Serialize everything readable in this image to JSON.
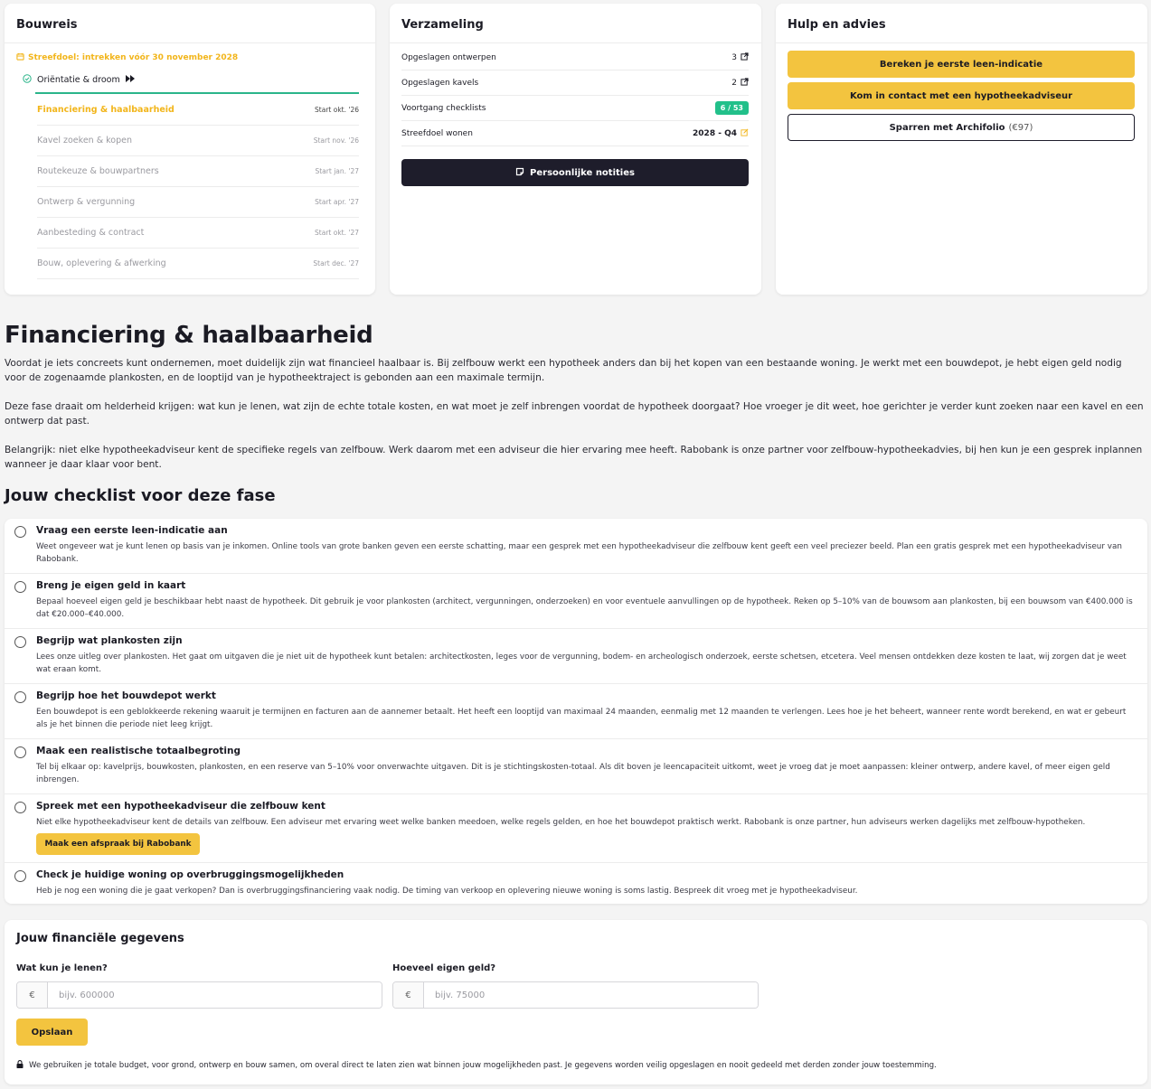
{
  "bouwreis": {
    "title": "Bouwreis",
    "goal": "Streefdoel: intrekken vóór 30 november 2028",
    "done_phase": "Oriëntatie & droom",
    "phases": [
      {
        "label": "Financiering & haalbaarheid",
        "start": "Start okt. '26"
      },
      {
        "label": "Kavel zoeken & kopen",
        "start": "Start nov. '26"
      },
      {
        "label": "Routekeuze & bouwpartners",
        "start": "Start jan. '27"
      },
      {
        "label": "Ontwerp & vergunning",
        "start": "Start apr. '27"
      },
      {
        "label": "Aanbesteding & contract",
        "start": "Start okt. '27"
      },
      {
        "label": "Bouw, oplevering & afwerking",
        "start": "Start dec. '27"
      }
    ]
  },
  "verzameling": {
    "title": "Verzameling",
    "rows": [
      {
        "label": "Opgeslagen ontwerpen",
        "value": "3"
      },
      {
        "label": "Opgeslagen kavels",
        "value": "2"
      },
      {
        "label": "Voortgang checklists",
        "value": "6 / 53"
      },
      {
        "label": "Streefdoel wonen",
        "value": "2028 - Q4"
      }
    ],
    "notes_button": "Persoonlijke notities"
  },
  "hulp": {
    "title": "Hulp en advies",
    "button1": "Bereken je eerste leen-indicatie",
    "button2": "Kom in contact met een hypotheekadviseur",
    "button3": "Sparren met Archifolio",
    "button3_price": "(€97)"
  },
  "phase": {
    "title": "Financiering & haalbaarheid",
    "p1": "Voordat je iets concreets kunt ondernemen, moet duidelijk zijn wat financieel haalbaar is. Bij zelfbouw werkt een hypotheek anders dan bij het kopen van een bestaande woning. Je werkt met een bouwdepot, je hebt eigen geld nodig voor de zogenaamde plankosten, en de looptijd van je hypotheektraject is gebonden aan een maximale termijn.",
    "p2": "Deze fase draait om helderheid krijgen: wat kun je lenen, wat zijn de echte totale kosten, en wat moet je zelf inbrengen voordat de hypotheek doorgaat? Hoe vroeger je dit weet, hoe gerichter je verder kunt zoeken naar een kavel en een ontwerp dat past.",
    "p3": "Belangrijk: niet elke hypotheekadviseur kent de specifieke regels van zelfbouw. Werk daarom met een adviseur die hier ervaring mee heeft. Rabobank is onze partner voor zelfbouw-hypotheekadvies, bij hen kun je een gesprek inplannen wanneer je daar klaar voor bent."
  },
  "checklist": {
    "title": "Jouw checklist voor deze fase",
    "items": [
      {
        "title": "Vraag een eerste leen-indicatie aan",
        "desc": "Weet ongeveer wat je kunt lenen op basis van je inkomen. Online tools van grote banken geven een eerste schatting, maar een gesprek met een hypotheekadviseur die zelfbouw kent geeft een veel preciezer beeld. Plan een gratis gesprek met een hypotheekadviseur van Rabobank."
      },
      {
        "title": "Breng je eigen geld in kaart",
        "desc": "Bepaal hoeveel eigen geld je beschikbaar hebt naast de hypotheek. Dit gebruik je voor plankosten (architect, vergunningen, onderzoeken) en voor eventuele aanvullingen op de hypotheek. Reken op 5–10% van de bouwsom aan plankosten, bij een bouwsom van €400.000 is dat €20.000–€40.000."
      },
      {
        "title": "Begrijp wat plankosten zijn",
        "desc": "Lees onze uitleg over plankosten. Het gaat om uitgaven die je niet uit de hypotheek kunt betalen: architectkosten, leges voor de vergunning, bodem- en archeologisch onderzoek, eerste schetsen, etcetera. Veel mensen ontdekken deze kosten te laat, wij zorgen dat je weet wat eraan komt."
      },
      {
        "title": "Begrijp hoe het bouwdepot werkt",
        "desc": "Een bouwdepot is een geblokkeerde rekening waaruit je termijnen en facturen aan de aannemer betaalt. Het heeft een looptijd van maximaal 24 maanden, eenmalig met 12 maanden te verlengen. Lees hoe je het beheert, wanneer rente wordt berekend, en wat er gebeurt als je het binnen die periode niet leeg krijgt."
      },
      {
        "title": "Maak een realistische totaalbegroting",
        "desc": "Tel bij elkaar op: kavelprijs, bouwkosten, plankosten, en een reserve van 5–10% voor onverwachte uitgaven. Dit is je stichtingskosten-totaal. Als dit boven je leencapaciteit uitkomt, weet je vroeg dat je moet aanpassen: kleiner ontwerp, andere kavel, of meer eigen geld inbrengen."
      },
      {
        "title": "Spreek met een hypotheekadviseur die zelfbouw kent",
        "desc": "Niet elke hypotheekadviseur kent de details van zelfbouw. Een adviseur met ervaring weet welke banken meedoen, welke regels gelden, en hoe het bouwdepot praktisch werkt. Rabobank is onze partner, hun adviseurs werken dagelijks met zelfbouw-hypotheken.",
        "button": "Maak een afspraak bij Rabobank"
      },
      {
        "title": "Check je huidige woning op overbruggingsmogelijkheden",
        "desc": "Heb je nog een woning die je gaat verkopen? Dan is overbruggingsfinanciering vaak nodig. De timing van verkoop en oplevering nieuwe woning is soms lastig. Bespreek dit vroeg met je hypotheekadviseur."
      }
    ]
  },
  "finance": {
    "title": "Jouw financiële gegevens",
    "loan_label": "Wat kun je lenen?",
    "loan_placeholder": "bijv. 600000",
    "own_label": "Hoeveel eigen geld?",
    "own_placeholder": "bijv. 75000",
    "currency": "€",
    "save": "Opslaan",
    "privacy": "We gebruiken je totale budget, voor grond, ontwerp en bouw samen, om overal direct te laten zien wat binnen jouw mogelijkheden past. Je gegevens worden veilig opgeslagen en nooit gedeeld met derden zonder jouw toestemming."
  },
  "colors": {
    "accent": "#f3c43f",
    "goal_text": "#f2b51a",
    "success": "#22c08a",
    "dark": "#1e1d2b"
  }
}
